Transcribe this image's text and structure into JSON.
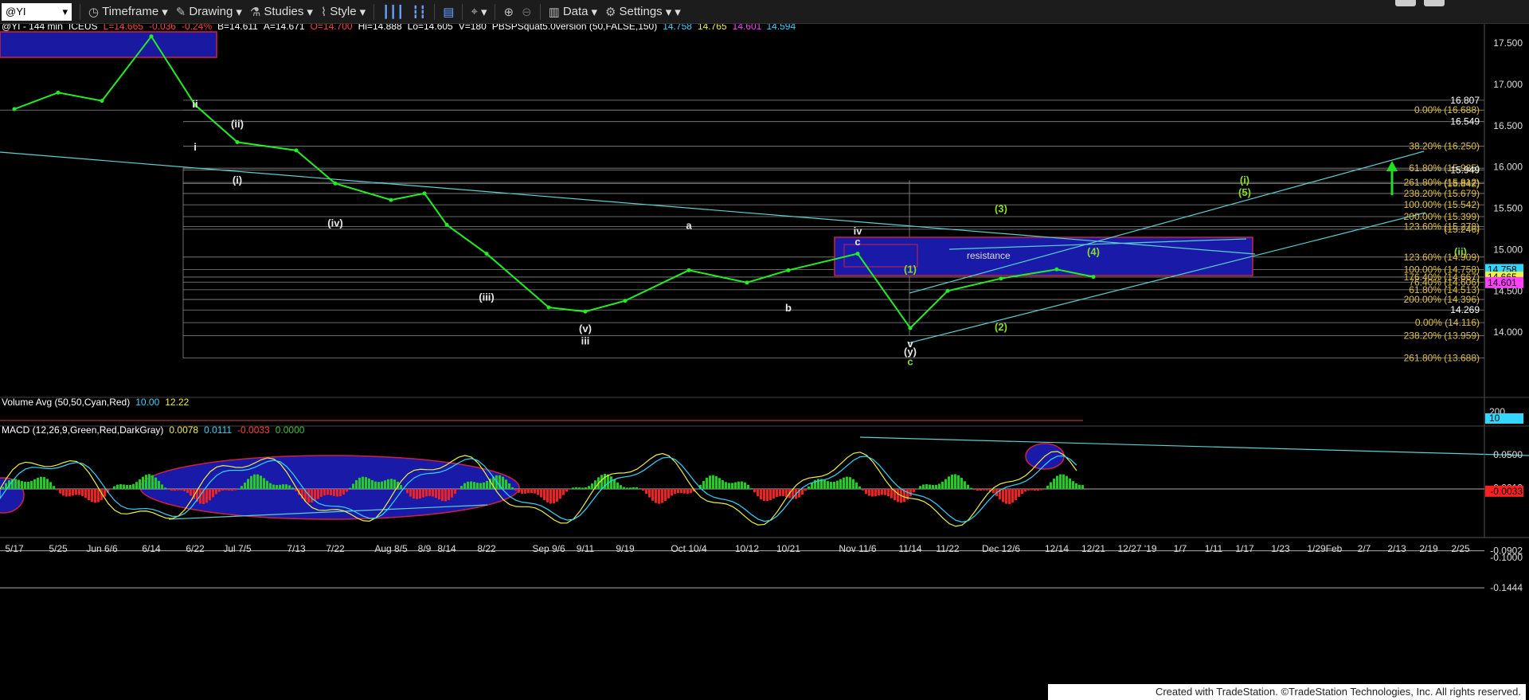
{
  "toolbar": {
    "symbol": "@YI",
    "items": [
      "Timeframe",
      "Drawing",
      "Studies",
      "Style",
      "Data",
      "Settings"
    ]
  },
  "header_line": [
    {
      "text": "@YI - 144 min",
      "color": "#ffffff"
    },
    {
      "text": "ICEUS",
      "color": "#ffffff"
    },
    {
      "text": "L=14.665",
      "color": "#ff4040"
    },
    {
      "text": "-0.036",
      "color": "#ff4040"
    },
    {
      "text": "-0.24%",
      "color": "#ff4040"
    },
    {
      "text": "B=14.611",
      "color": "#ffffff"
    },
    {
      "text": "A=14.671",
      "color": "#ffffff"
    },
    {
      "text": "O=14.700",
      "color": "#ff4040"
    },
    {
      "text": "Hi=14.888",
      "color": "#ffffff"
    },
    {
      "text": "Lo=14.605",
      "color": "#ffffff"
    },
    {
      "text": "V=180",
      "color": "#ffffff"
    },
    {
      "text": "PBSPSquat5.0version (50,FALSE,150)",
      "color": "#ffffff"
    },
    {
      "text": "14.758",
      "color": "#33d6ff"
    },
    {
      "text": "14.765",
      "color": "#f0f040"
    },
    {
      "text": "14.601",
      "color": "#ff40ff"
    },
    {
      "text": "14.594",
      "color": "#33d6ff"
    }
  ],
  "volume_header": [
    {
      "text": "Volume Avg (50,50,Cyan,Red)",
      "color": "#ffffff"
    },
    {
      "text": "10.00",
      "color": "#33d6ff"
    },
    {
      "text": "12.22",
      "color": "#f0f040"
    }
  ],
  "macd_header": [
    {
      "text": "MACD (12,26,9,Green,Red,DarkGray)",
      "color": "#ffffff"
    },
    {
      "text": "0.0078",
      "color": "#f0f040"
    },
    {
      "text": "0.0111",
      "color": "#33d6ff"
    },
    {
      "text": "-0.0033",
      "color": "#ff4040"
    },
    {
      "text": "0.0000",
      "color": "#40c040"
    }
  ],
  "footer": "Created with TradeStation. ©TradeStation Technologies, Inc. All rights reserved.",
  "chart_data": {
    "type": "line",
    "price_axis": {
      "range": [
        13.45,
        17.72
      ],
      "ticks": [
        14.0,
        14.5,
        15.0,
        15.5,
        16.0,
        16.5,
        17.0,
        17.5
      ]
    },
    "x_tick_labels": [
      "5/17",
      "5/25",
      "Jun 6/6",
      "6/14",
      "6/22",
      "Jul 7/5",
      "7/13",
      "7/22",
      "Aug 8/5",
      "8/9",
      "8/14",
      "8/22",
      "Sep 9/6",
      "9/11",
      "9/19",
      "Oct 10/4",
      "10/12",
      "10/21",
      "Nov 11/6",
      "11/14",
      "11/22",
      "Dec 12/6",
      "12/14",
      "12/21",
      "12/27 '19",
      "1/7",
      "1/11",
      "1/17",
      "1/23",
      "1/29",
      "Feb",
      "2/7",
      "2/13",
      "2/19",
      "2/25"
    ],
    "price_points": [
      [
        "5/17",
        16.7
      ],
      [
        "5/25",
        16.9
      ],
      [
        "Jun 6/6",
        16.8
      ],
      [
        "6/14",
        17.58
      ],
      [
        "6/22",
        16.75
      ],
      [
        "Jul 7/5",
        16.3
      ],
      [
        "7/13",
        16.2
      ],
      [
        "7/22",
        15.8
      ],
      [
        "Aug 8/5",
        15.6
      ],
      [
        "8/9",
        15.68
      ],
      [
        "8/14",
        15.3
      ],
      [
        "8/22",
        14.95
      ],
      [
        "Sep 9/6",
        14.3
      ],
      [
        "9/11",
        14.25
      ],
      [
        "9/19",
        14.38
      ],
      [
        "Oct 10/4",
        14.75
      ],
      [
        "10/12",
        14.6
      ],
      [
        "10/21",
        14.75
      ],
      [
        "Nov 11/6",
        14.95
      ],
      [
        "11/14",
        14.05
      ],
      [
        "11/22",
        14.5
      ],
      [
        "Dec 12/6",
        14.65
      ],
      [
        "12/14",
        14.76
      ],
      [
        "12/21",
        14.67
      ]
    ],
    "right_axis_labels": [
      {
        "price": 16.807,
        "text": "16.807"
      },
      {
        "price": 16.688,
        "text": "0.00% (16.688)"
      },
      {
        "price": 16.549,
        "text": "16.549"
      },
      {
        "price": 16.25,
        "text": "38.20% (16.250)"
      },
      {
        "price": 15.985,
        "text": "61.80% (15.985)"
      },
      {
        "price": 15.964,
        "text": "15.949"
      },
      {
        "price": 15.812,
        "text": "261.80% (15.812)"
      },
      {
        "price": 15.8,
        "text": "(15.842)"
      },
      {
        "price": 15.679,
        "text": "238.20% (15.679)"
      },
      {
        "price": 15.542,
        "text": "100.00% (15.542)"
      },
      {
        "price": 15.399,
        "text": "200.00% (15.399)"
      },
      {
        "price": 15.278,
        "text": "123.60% (15.278)"
      },
      {
        "price": 15.246,
        "text": "(15.246)"
      },
      {
        "price": 14.909,
        "text": "123.60% (14.909)"
      },
      {
        "price": 14.758,
        "text": "100.00% (14.758)"
      },
      {
        "price": 14.667,
        "text": "176.40% (14.667)"
      },
      {
        "price": 14.606,
        "text": "76.40% (14.606)"
      },
      {
        "price": 14.513,
        "text": "61.80% (14.513)"
      },
      {
        "price": 14.396,
        "text": "200.00% (14.396)"
      },
      {
        "price": 14.269,
        "text": "14.269"
      },
      {
        "price": 14.116,
        "text": "0.00% (14.116)"
      },
      {
        "price": 13.959,
        "text": "238.20% (13.959)"
      },
      {
        "price": 13.688,
        "text": "261.80% (13.688)"
      }
    ],
    "last_price_tags": [
      {
        "price": 14.758,
        "text": "14.758",
        "color": "#33d6ff"
      },
      {
        "price": 14.665,
        "text": "14.665",
        "color": "#f0f040"
      },
      {
        "price": 14.601,
        "text": "14.601",
        "color": "#ff40ff"
      }
    ],
    "wave_labels": [
      {
        "x": "6/22",
        "price": 16.72,
        "text": "ii"
      },
      {
        "x": "6/22",
        "price": 16.2,
        "text": "i"
      },
      {
        "x": "Jul 7/5",
        "price": 16.48,
        "text": "(ii)"
      },
      {
        "x": "Jul 7/5",
        "price": 15.8,
        "text": "(i)"
      },
      {
        "x": "7/22",
        "price": 15.28,
        "text": "(iv)"
      },
      {
        "x": "8/22",
        "price": 14.38,
        "text": "(iii)"
      },
      {
        "x": "9/11",
        "price": 14.0,
        "text": "(v)"
      },
      {
        "x": "9/11",
        "price": 13.85,
        "text": "iii"
      },
      {
        "x": "Oct 10/4",
        "price": 15.25,
        "text": "a"
      },
      {
        "x": "10/21",
        "price": 14.25,
        "text": "b"
      },
      {
        "x": "Nov 11/6",
        "price": 15.05,
        "text": "c"
      },
      {
        "x": "Nov 11/6",
        "price": 15.18,
        "text": "iv"
      },
      {
        "x": "11/14",
        "price": 13.82,
        "text": "v"
      },
      {
        "x": "11/14",
        "price": 13.72,
        "text": "(y)"
      },
      {
        "x": "11/14",
        "price": 13.6,
        "text": "c"
      },
      {
        "x": "11/14",
        "price": 14.72,
        "text": "(1)"
      },
      {
        "x": "Dec 12/6",
        "price": 14.02,
        "text": "(2)"
      },
      {
        "x": "Dec 12/6",
        "price": 15.45,
        "text": "(3)"
      },
      {
        "x": "12/21",
        "price": 14.93,
        "text": "(4)"
      },
      {
        "x": "1/17",
        "price": 15.65,
        "text": "(5)"
      },
      {
        "x": "1/17",
        "price": 15.8,
        "text": "(i)"
      },
      {
        "x": "2/25",
        "price": 14.93,
        "text": "(ii)"
      }
    ],
    "annotation": "resistance",
    "volume_axis": {
      "ticks": [
        "200",
        "10"
      ]
    },
    "macd_axis": {
      "ticks": [
        0.05,
        0.0019,
        -0.0033,
        -0.0902,
        -0.1,
        -0.1444
      ]
    }
  }
}
